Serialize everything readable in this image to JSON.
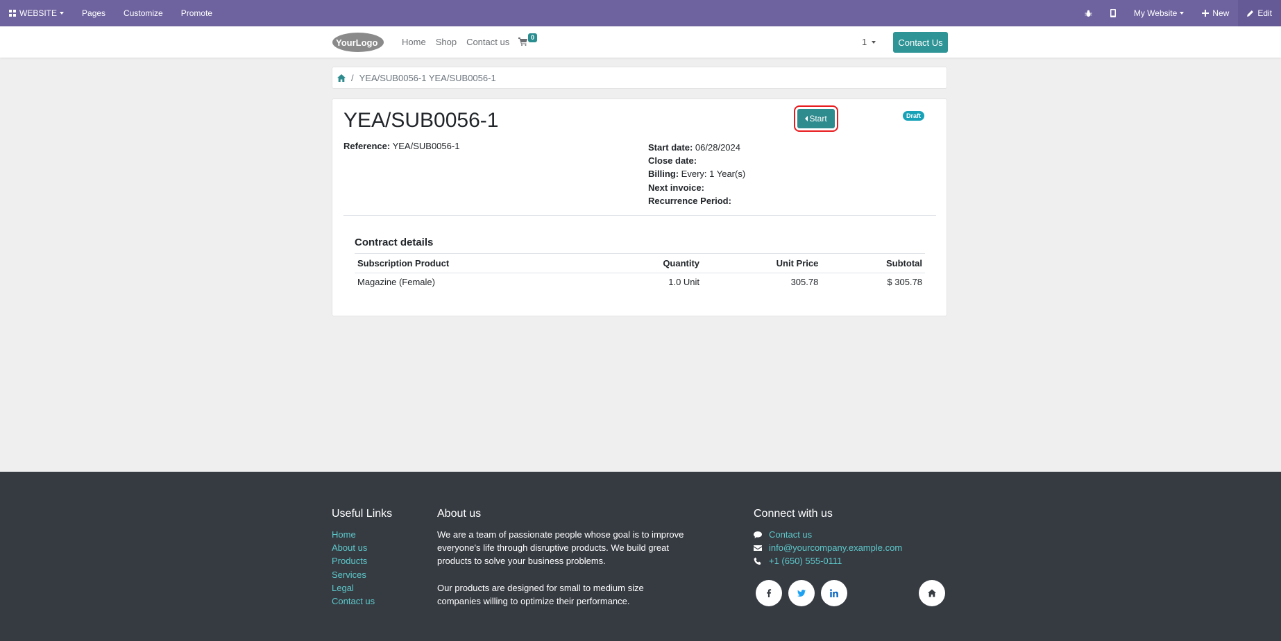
{
  "adminbar": {
    "website_label": "WEBSITE",
    "pages_label": "Pages",
    "customize_label": "Customize",
    "promote_label": "Promote",
    "my_website_label": "My Website",
    "new_label": "New",
    "edit_label": "Edit"
  },
  "header": {
    "logo_text": "YourLogo",
    "nav": [
      "Home",
      "Shop",
      "Contact us"
    ],
    "cart_count": "0",
    "lang_label": "1",
    "contact_button": "Contact Us"
  },
  "breadcrumb": {
    "separator": "/",
    "current": "YEA/SUB0056-1 YEA/SUB0056-1"
  },
  "subscription": {
    "title": "YEA/SUB0056-1",
    "start_button": "Start",
    "status": "Draft",
    "reference_label": "Reference:",
    "reference_value": "YEA/SUB0056-1",
    "start_date_label": "Start date:",
    "start_date_value": "06/28/2024",
    "close_date_label": "Close date:",
    "close_date_value": "",
    "billing_label": "Billing:",
    "billing_value": "Every: 1 Year(s)",
    "next_invoice_label": "Next invoice:",
    "next_invoice_value": "",
    "recurrence_label": "Recurrence Period:",
    "recurrence_value": ""
  },
  "contract": {
    "title": "Contract details",
    "columns": [
      "Subscription Product",
      "Quantity",
      "Unit Price",
      "Subtotal"
    ],
    "rows": [
      {
        "product": "Magazine (Female)",
        "quantity": "1.0 Unit",
        "unit_price": "305.78",
        "subtotal": "$ 305.78"
      }
    ]
  },
  "footer": {
    "useful_links_title": "Useful Links",
    "useful_links": [
      "Home",
      "About us",
      "Products",
      "Services",
      "Legal",
      "Contact us"
    ],
    "about_title": "About us",
    "about_p1": "We are a team of passionate people whose goal is to improve everyone's life through disruptive products. We build great products to solve your business problems.",
    "about_p2": "Our products are designed for small to medium size companies willing to optimize their performance.",
    "connect_title": "Connect with us",
    "contact_link": "Contact us",
    "email": "info@yourcompany.example.com",
    "phone": "+1 (650) 555-0111"
  },
  "colors": {
    "adminbar": "#6f639f",
    "primary": "#2e9496",
    "footer": "#363b42",
    "link": "#5cc9cb",
    "highlight": "#e8191c"
  }
}
